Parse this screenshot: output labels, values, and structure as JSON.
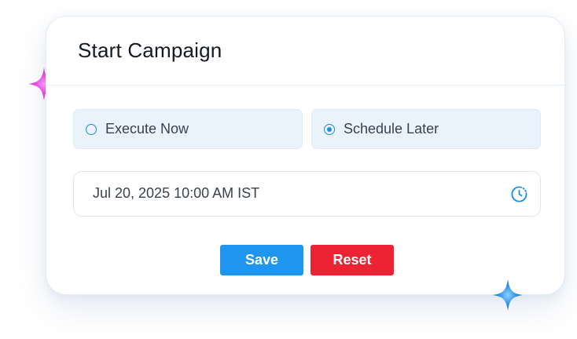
{
  "dialog": {
    "title": "Start Campaign"
  },
  "options": [
    {
      "label": "Execute Now",
      "selected": false
    },
    {
      "label": "Schedule Later",
      "selected": true
    }
  ],
  "schedule": {
    "datetime_value": "Jul 20, 2025 10:00 AM IST",
    "picker_icon": "clock-icon"
  },
  "actions": {
    "save_label": "Save",
    "reset_label": "Reset"
  },
  "colors": {
    "accent": "#1e96f0",
    "danger": "#ec2332",
    "option_bg": "#eaf3fc",
    "sparkle_pink": "#f03ae6",
    "sparkle_blue": "#2b8ee8"
  }
}
